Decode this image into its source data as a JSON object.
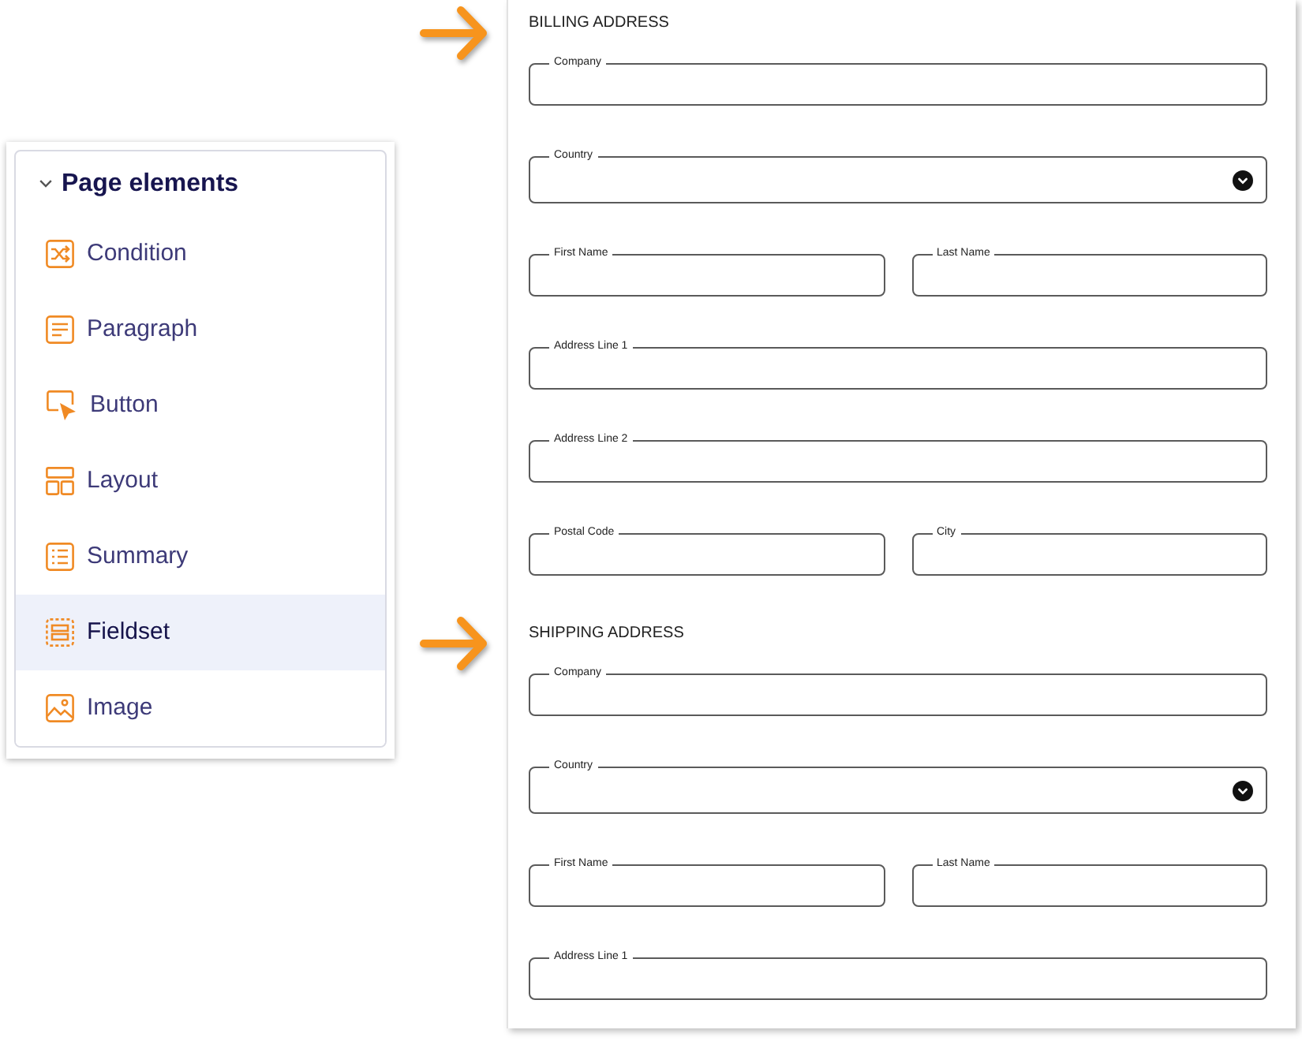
{
  "panel": {
    "title": "Page elements",
    "expanded": true,
    "items": [
      {
        "label": "Condition",
        "selected": false
      },
      {
        "label": "Paragraph",
        "selected": false
      },
      {
        "label": "Button",
        "selected": false
      },
      {
        "label": "Layout",
        "selected": false
      },
      {
        "label": "Summary",
        "selected": false
      },
      {
        "label": "Fieldset",
        "selected": true
      },
      {
        "label": "Image",
        "selected": false
      }
    ]
  },
  "form": {
    "sections": [
      {
        "heading": "BILLING ADDRESS",
        "arrow": true,
        "rows": [
          {
            "fields": [
              {
                "label": "Company",
                "kind": "text"
              }
            ]
          },
          {
            "fields": [
              {
                "label": "Country",
                "kind": "select"
              }
            ]
          },
          {
            "fields": [
              {
                "label": "First Name",
                "kind": "text"
              },
              {
                "label": "Last Name",
                "kind": "text"
              }
            ]
          },
          {
            "fields": [
              {
                "label": "Address Line 1",
                "kind": "text"
              }
            ]
          },
          {
            "fields": [
              {
                "label": "Address Line 2",
                "kind": "text"
              }
            ]
          },
          {
            "fields": [
              {
                "label": "Postal Code",
                "kind": "text"
              },
              {
                "label": "City",
                "kind": "text"
              }
            ]
          }
        ]
      },
      {
        "heading": "SHIPPING ADDRESS",
        "arrow": true,
        "rows": [
          {
            "fields": [
              {
                "label": "Company",
                "kind": "text"
              }
            ]
          },
          {
            "fields": [
              {
                "label": "Country",
                "kind": "select"
              }
            ]
          },
          {
            "fields": [
              {
                "label": "First Name",
                "kind": "text"
              },
              {
                "label": "Last Name",
                "kind": "text"
              }
            ]
          },
          {
            "fields": [
              {
                "label": "Address Line 1",
                "kind": "text"
              }
            ]
          }
        ]
      }
    ]
  }
}
